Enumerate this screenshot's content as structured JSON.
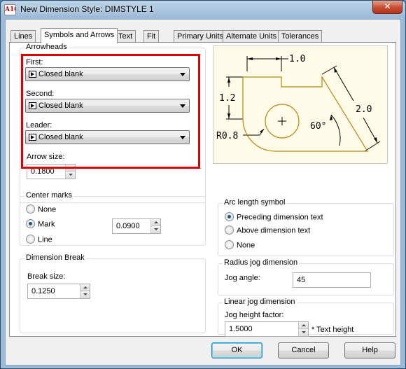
{
  "window": {
    "title": "New Dimension Style: DIMSTYLE 1",
    "app_icon_text": "A10",
    "close_glyph": "✕"
  },
  "tabs": [
    {
      "label": "Lines",
      "active": false
    },
    {
      "label": "Symbols and Arrows",
      "active": true
    },
    {
      "label": "Text",
      "active": false
    },
    {
      "label": "Fit",
      "active": false
    },
    {
      "label": "Primary Units",
      "active": false
    },
    {
      "label": "Alternate Units",
      "active": false
    },
    {
      "label": "Tolerances",
      "active": false
    }
  ],
  "arrowheads": {
    "group_label": "Arrowheads",
    "first_label": "First:",
    "first_value": "Closed blank",
    "second_label": "Second:",
    "second_value": "Closed blank",
    "leader_label": "Leader:",
    "leader_value": "Closed blank",
    "arrow_size_label": "Arrow size:",
    "arrow_size_value": "0.1800"
  },
  "center_marks": {
    "group_label": "Center marks",
    "none_label": "None",
    "mark_label": "Mark",
    "line_label": "Line",
    "selected": "Mark",
    "size_value": "0.0900"
  },
  "dimension_break": {
    "group_label": "Dimension Break",
    "break_size_label": "Break size:",
    "break_size_value": "0.1250"
  },
  "preview": {
    "dim_top": "1.0",
    "dim_left": "1.2",
    "dim_right": "2.0",
    "dim_angle": "60°",
    "dim_radius": "R0.8",
    "center_mark_glyph": "+"
  },
  "arc_length_symbol": {
    "group_label": "Arc length symbol",
    "preceding_label": "Preceding dimension text",
    "above_label": "Above dimension text",
    "none_label": "None",
    "selected": "Preceding dimension text"
  },
  "radius_jog": {
    "group_label": "Radius jog dimension",
    "jog_angle_label": "Jog angle:",
    "jog_angle_value": "45"
  },
  "linear_jog": {
    "group_label": "Linear jog dimension",
    "jog_height_label": "Jog height factor:",
    "jog_height_value": "1.5000",
    "suffix": "* Text height"
  },
  "buttons": {
    "ok": "OK",
    "cancel": "Cancel",
    "help": "Help"
  },
  "colors": {
    "highlight": "#e00000",
    "preview_background": "#fffbe8",
    "preview_shape": "#b8860b"
  }
}
